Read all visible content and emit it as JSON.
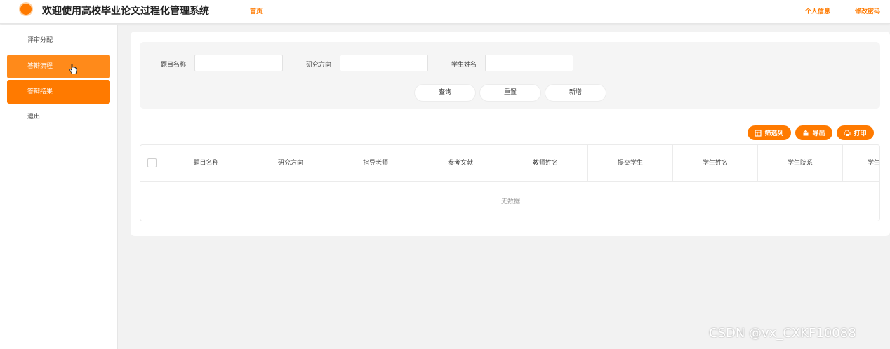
{
  "header": {
    "app_title": "欢迎使用高校毕业论文过程化管理系统",
    "nav_home": "首页",
    "nav_profile": "个人信息",
    "nav_password": "修改密码"
  },
  "sidebar": {
    "items": [
      {
        "label": "评审分配"
      },
      {
        "label": "答辩流程"
      },
      {
        "label": "答辩结果"
      },
      {
        "label": "退出"
      }
    ]
  },
  "search": {
    "fields": [
      {
        "label": "题目名称",
        "value": ""
      },
      {
        "label": "研究方向",
        "value": ""
      },
      {
        "label": "学生姓名",
        "value": ""
      }
    ],
    "query_label": "查询",
    "reset_label": "重置",
    "add_label": "新增"
  },
  "toolbar": {
    "filter_columns_label": "筛选列",
    "export_label": "导出",
    "print_label": "打印"
  },
  "table": {
    "columns": [
      "题目名称",
      "研究方向",
      "指导老师",
      "参考文献",
      "教师姓名",
      "提交学生",
      "学生姓名",
      "学生院系",
      "学生"
    ],
    "empty_text": "无数据"
  },
  "colors": {
    "accent": "#ff7a00",
    "background": "#f2f2f2"
  },
  "watermark": "CSDN @vx_CXKF10088"
}
